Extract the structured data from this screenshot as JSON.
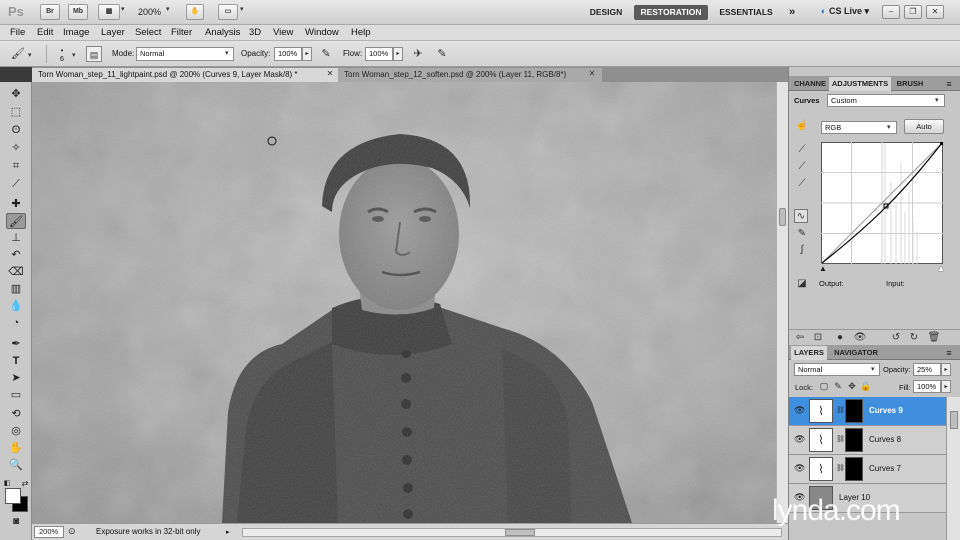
{
  "appbar": {
    "logo": "Ps",
    "btn_br": "Br",
    "btn_mb": "Mb",
    "zoom": "200%",
    "workspaces": [
      {
        "label": "DESIGN",
        "active": false
      },
      {
        "label": "RESTORATION",
        "active": true
      },
      {
        "label": "ESSENTIALS",
        "active": false
      }
    ],
    "more": "»",
    "cslive": "CS Live"
  },
  "menu": [
    "File",
    "Edit",
    "Image",
    "Layer",
    "Select",
    "Filter",
    "Analysis",
    "3D",
    "View",
    "Window",
    "Help"
  ],
  "options": {
    "brush_size": "6",
    "mode_label": "Mode:",
    "mode_value": "Normal",
    "opacity_label": "Opacity:",
    "opacity_value": "100%",
    "flow_label": "Flow:",
    "flow_value": "100%"
  },
  "tabs": [
    {
      "label": "Torn Woman_step_11_lightpaint.psd @ 200% (Curves 9, Layer Mask/8) *",
      "active": true
    },
    {
      "label": "Torn Woman_step_12_soften.psd @ 200% (Layer 11, RGB/8*)",
      "active": false
    }
  ],
  "status": {
    "zoom": "200%",
    "text": "Exposure works in 32-bit only"
  },
  "adjust_panel": {
    "tabs": [
      "CHANNE",
      "ADJUSTMENTS",
      "BRUSH"
    ],
    "curves_label": "Curves",
    "preset": "Custom",
    "channel": "RGB",
    "auto_label": "Auto",
    "output_label": "Output:",
    "input_label": "Input:"
  },
  "layers_panel": {
    "tabs": [
      "LAYERS",
      "NAVIGATOR"
    ],
    "blend": "Normal",
    "opacity_label": "Opacity:",
    "opacity_value": "25%",
    "lock_label": "Lock:",
    "fill_label": "Fill:",
    "fill_value": "100%",
    "layers": [
      {
        "name": "Curves 9",
        "selected": true
      },
      {
        "name": "Curves 8",
        "selected": false
      },
      {
        "name": "Curves 7",
        "selected": false
      },
      {
        "name": "Layer 10",
        "selected": false
      }
    ]
  },
  "watermark": "lynda.com",
  "colors": {
    "accent": "#3f8fde",
    "workspace_active": "#5a5a5a",
    "panel_bg": "#c6c6c6",
    "chrome": "#dcdcdc"
  },
  "icons": [
    "brush-icon",
    "eye-icon",
    "chain-icon",
    "move-tool-icon",
    "marquee-tool-icon",
    "lasso-tool-icon",
    "crop-tool-icon",
    "eyedropper-icon",
    "type-tool-icon",
    "hand-tool-icon",
    "zoom-tool-icon"
  ]
}
